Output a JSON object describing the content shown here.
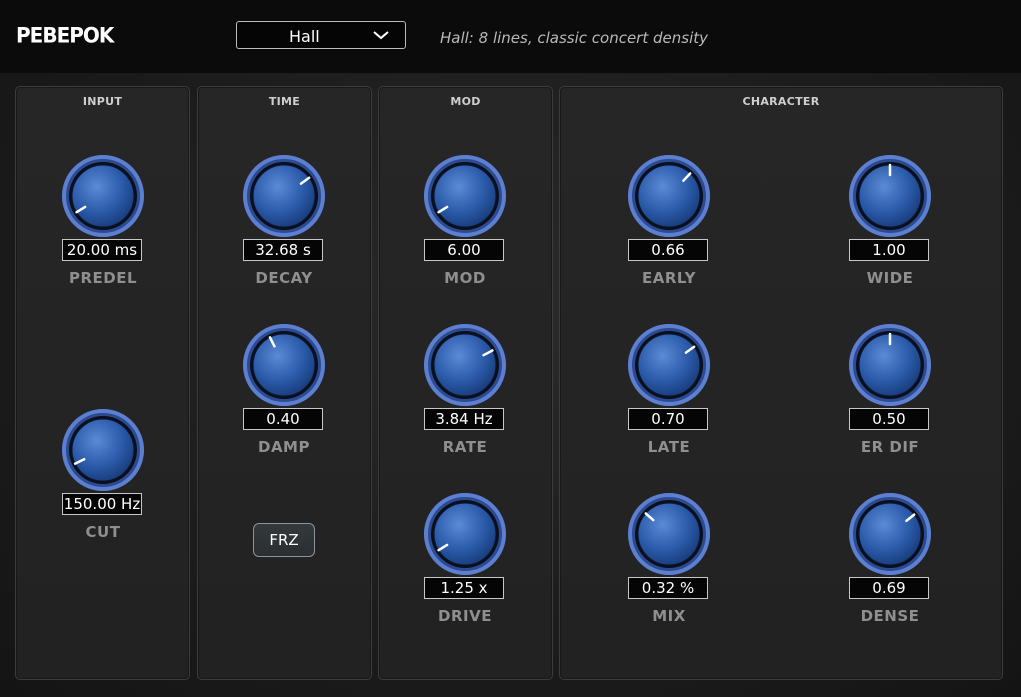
{
  "app": {
    "logo": "PEBEPOK"
  },
  "preset": {
    "value": "Hall",
    "description": "Hall: 8 lines, classic concert density"
  },
  "panels": [
    {
      "id": "input",
      "title": "INPUT"
    },
    {
      "id": "time",
      "title": "TIME"
    },
    {
      "id": "mod",
      "title": "MOD"
    },
    {
      "id": "character",
      "title": "CHARACTER"
    }
  ],
  "knobs": [
    {
      "id": "predel",
      "label": "PREDEL",
      "value": "20.00 ms",
      "norm": 0.05
    },
    {
      "id": "cut",
      "label": "CUT",
      "value": "150.00 Hz",
      "norm": 0.07
    },
    {
      "id": "decay",
      "label": "DECAY",
      "value": "32.68 s",
      "norm": 0.7
    },
    {
      "id": "damp",
      "label": "DAMP",
      "value": "0.40",
      "norm": 0.4
    },
    {
      "id": "mod",
      "label": "MOD",
      "value": "6.00",
      "norm": 0.05
    },
    {
      "id": "rate",
      "label": "RATE",
      "value": "3.84 Hz",
      "norm": 0.73
    },
    {
      "id": "drive",
      "label": "DRIVE",
      "value": "1.25 x",
      "norm": 0.05
    },
    {
      "id": "early",
      "label": "EARLY",
      "value": "0.66",
      "norm": 0.66
    },
    {
      "id": "late",
      "label": "LATE",
      "value": "0.70",
      "norm": 0.7
    },
    {
      "id": "mix",
      "label": "MIX",
      "value": "0.32 %",
      "norm": 0.32
    },
    {
      "id": "wide",
      "label": "WIDE",
      "value": "1.00",
      "norm": 0.5
    },
    {
      "id": "erdif",
      "label": "ER DIF",
      "value": "0.50",
      "norm": 0.5
    },
    {
      "id": "dense",
      "label": "DENSE",
      "value": "0.69",
      "norm": 0.69
    }
  ],
  "buttons": {
    "freeze": "FRZ"
  },
  "colors": {
    "knob_face": "#2a5aa8",
    "knob_ring": "#5d7fd0",
    "label": "#8f8f8f"
  }
}
